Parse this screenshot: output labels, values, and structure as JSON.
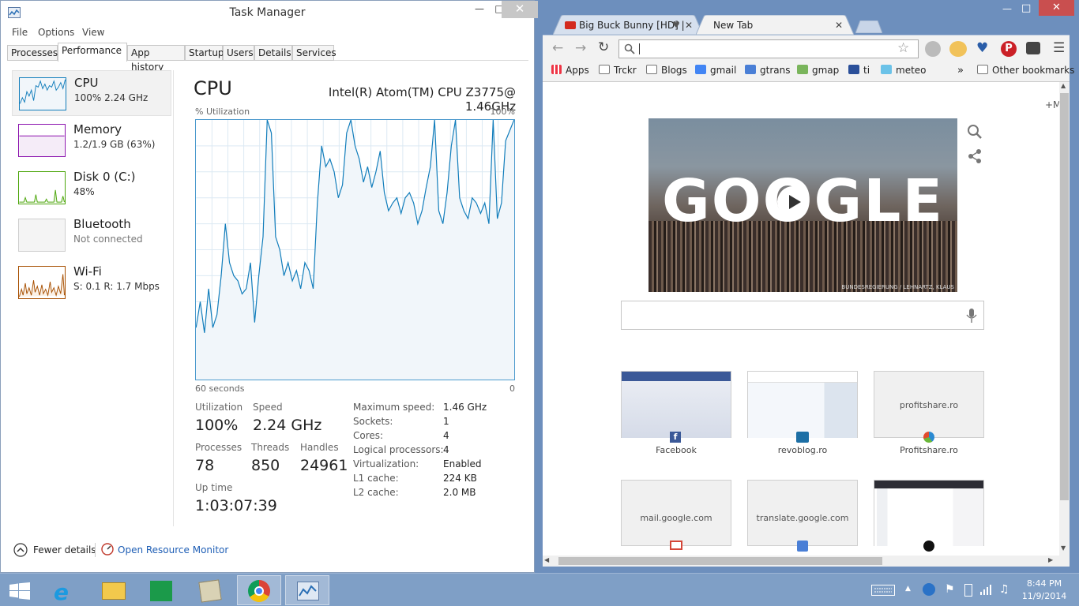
{
  "taskmanager": {
    "title": "Task Manager",
    "menu": [
      "File",
      "Options",
      "View"
    ],
    "tabs": [
      "Processes",
      "Performance",
      "App history",
      "Startup",
      "Users",
      "Details",
      "Services"
    ],
    "resources": [
      {
        "name": "CPU",
        "sub": "100%  2.24 GHz",
        "color": "#117dbb"
      },
      {
        "name": "Memory",
        "sub": "1.2/1.9 GB (63%)",
        "color": "#8b12ae"
      },
      {
        "name": "Disk 0 (C:)",
        "sub": "48%",
        "color": "#4da60c"
      },
      {
        "name": "Bluetooth",
        "sub": "Not connected",
        "color": "#cccccc"
      },
      {
        "name": "Wi-Fi",
        "sub": "S: 0.1  R: 1.7 Mbps",
        "color": "#a74f01"
      }
    ],
    "detail": {
      "title": "CPU",
      "model": "Intel(R) Atom(TM) CPU Z3775@ 1.46GHz",
      "util_label": "% Utilization",
      "max_label": "100%",
      "time_label": "60 seconds",
      "zero_label": "0",
      "utilization_label": "Utilization",
      "utilization": "100%",
      "speed_label": "Speed",
      "speed": "2.24 GHz",
      "processes_label": "Processes",
      "processes": "78",
      "threads_label": "Threads",
      "threads": "850",
      "handles_label": "Handles",
      "handles": "24961",
      "uptime_label": "Up time",
      "uptime": "1:03:07:39",
      "specs": [
        {
          "k": "Maximum speed:",
          "v": "1.46 GHz"
        },
        {
          "k": "Sockets:",
          "v": "1"
        },
        {
          "k": "Cores:",
          "v": "4"
        },
        {
          "k": "Logical processors:",
          "v": "4"
        },
        {
          "k": "Virtualization:",
          "v": "Enabled"
        },
        {
          "k": "L1 cache:",
          "v": "224 KB"
        },
        {
          "k": "L2 cache:",
          "v": "2.0 MB"
        }
      ]
    },
    "cpu_history": [
      20,
      30,
      18,
      35,
      20,
      25,
      40,
      60,
      45,
      40,
      38,
      33,
      35,
      45,
      22,
      40,
      55,
      100,
      95,
      55,
      50,
      40,
      45,
      38,
      42,
      35,
      45,
      42,
      35,
      68,
      90,
      82,
      85,
      80,
      70,
      75,
      95,
      100,
      90,
      85,
      76,
      82,
      74,
      80,
      88,
      72,
      65,
      68,
      70,
      64,
      70,
      72,
      68,
      60,
      65,
      74,
      82,
      100,
      65,
      60,
      72,
      90,
      100,
      70,
      65,
      62,
      70,
      68,
      64,
      68,
      60,
      100,
      62,
      68,
      92,
      96,
      100
    ],
    "footer": {
      "fewer": "Fewer details",
      "monitor": "Open Resource Monitor"
    }
  },
  "chrome": {
    "tabs": [
      "Big Buck Bunny [HD] |",
      "New Tab"
    ],
    "bookmarks": [
      "Apps",
      "Trckr",
      "Blogs",
      "gmail",
      "gtrans",
      "gmap",
      "ti",
      "meteo"
    ],
    "other_bookmarks": "Other bookmarks",
    "more_label": "»",
    "plus_label": "+M",
    "doodle_text": "GOOGLE",
    "doodle_credit": "BUNDESREGIERUNG / LEHNARTZ, KLAUS",
    "tiles": [
      {
        "caption": "Facebook",
        "text": ""
      },
      {
        "caption": "revoblog.ro",
        "text": ""
      },
      {
        "caption": "Profitshare.ro",
        "text": "profitshare.ro"
      },
      {
        "caption": "",
        "text": "mail.google.com"
      },
      {
        "caption": "",
        "text": "translate.google.com"
      },
      {
        "caption": "",
        "text": ""
      }
    ]
  },
  "taskbar": {
    "time": "8:44 PM",
    "date": "11/9/2014"
  }
}
